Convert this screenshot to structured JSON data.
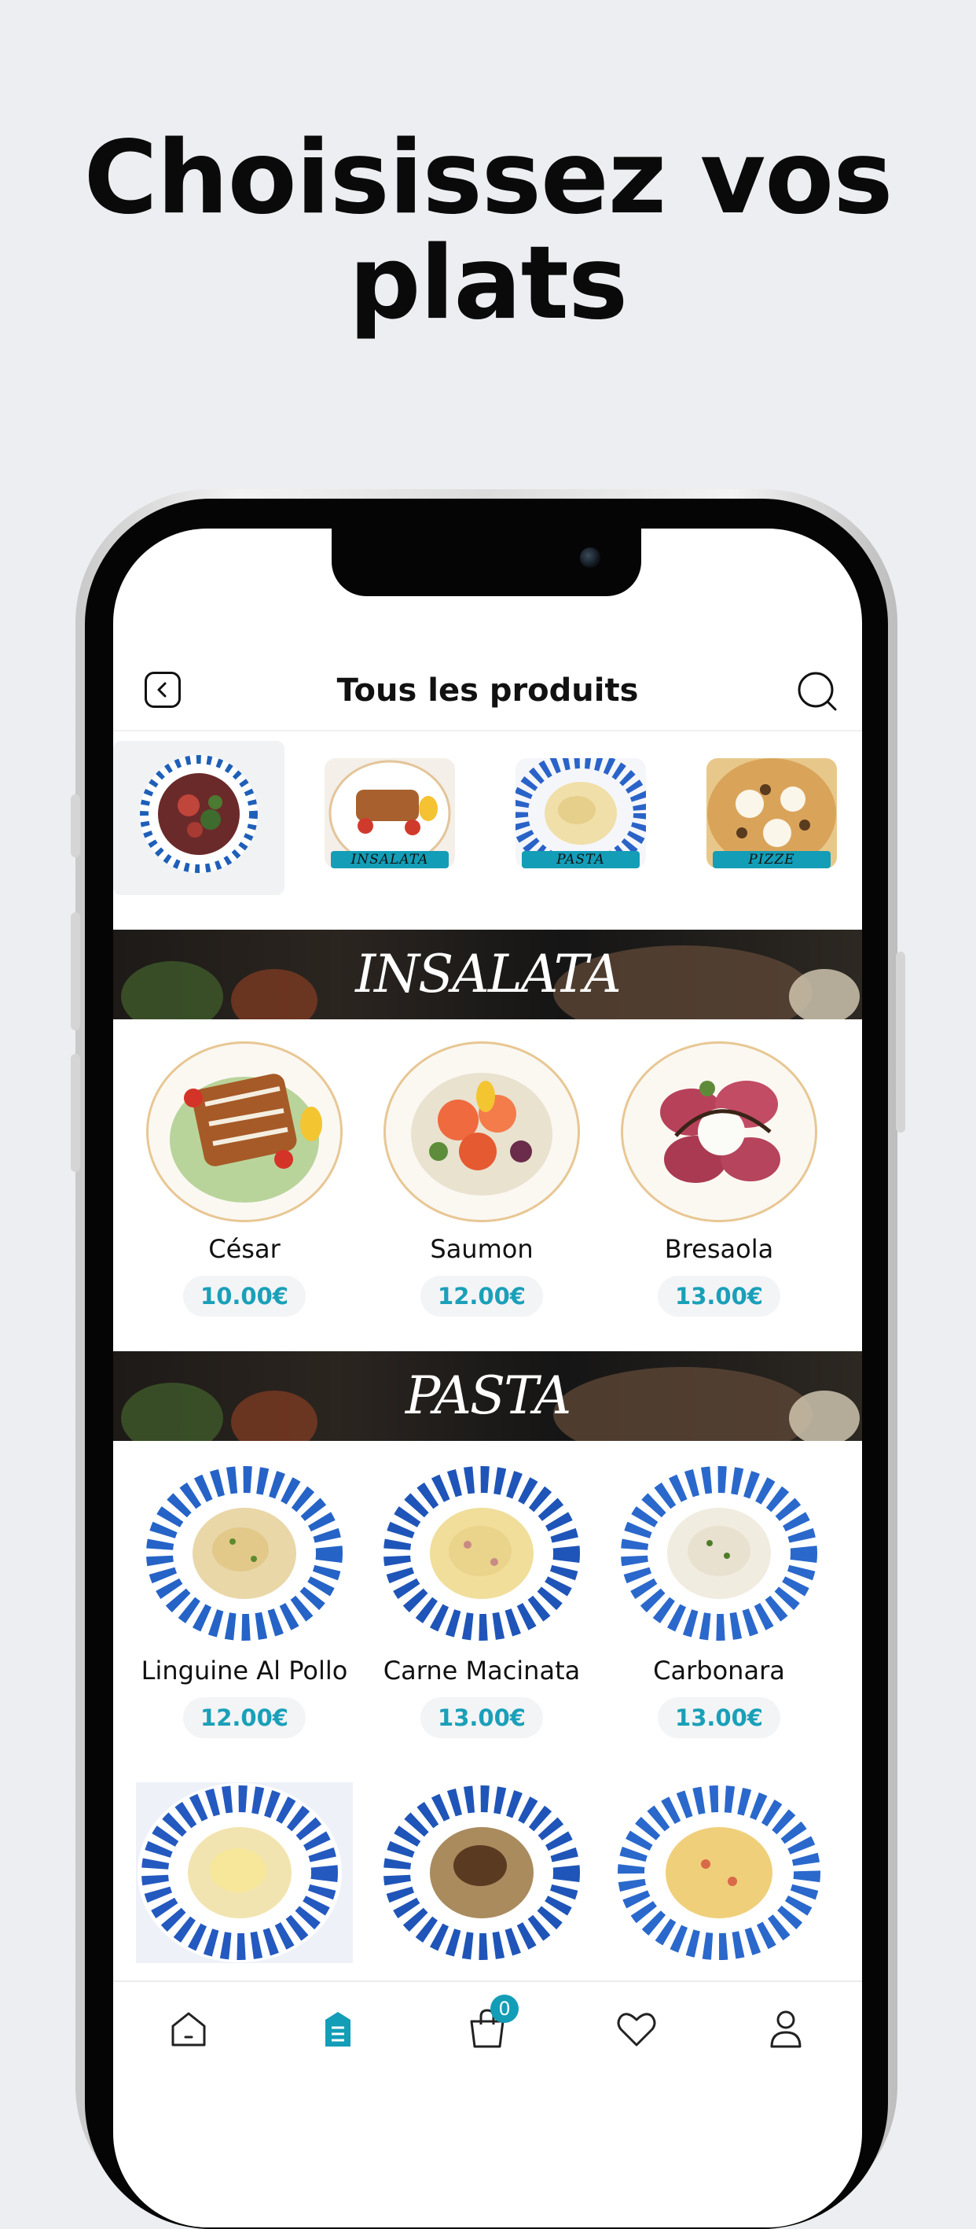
{
  "headline": {
    "line1": "Choisissez vos",
    "line2": "plats"
  },
  "header": {
    "title": "Tous les produits"
  },
  "categories": [
    {
      "label": ""
    },
    {
      "label": "INSALATA"
    },
    {
      "label": "PASTA"
    },
    {
      "label": "PIZZE"
    }
  ],
  "sections": [
    {
      "banner": "INSALATA",
      "products": [
        {
          "name": "César",
          "price": "10.00€"
        },
        {
          "name": "Saumon",
          "price": "12.00€"
        },
        {
          "name": "Bresaola",
          "price": "13.00€"
        }
      ]
    },
    {
      "banner": "PASTA",
      "products": [
        {
          "name": "Linguine Al Pollo",
          "price": "12.00€"
        },
        {
          "name": "Carne Macinata",
          "price": "13.00€"
        },
        {
          "name": "Carbonara",
          "price": "13.00€"
        }
      ]
    }
  ],
  "bottom_nav": {
    "items": [
      "home-icon",
      "menu-icon",
      "cart-icon",
      "heart-icon",
      "user-icon"
    ],
    "cart_count": "0"
  },
  "colors": {
    "accent": "#139db7",
    "price_text": "#1aa0b8",
    "price_bg": "#f3f4f6",
    "background": "#eceef1"
  }
}
